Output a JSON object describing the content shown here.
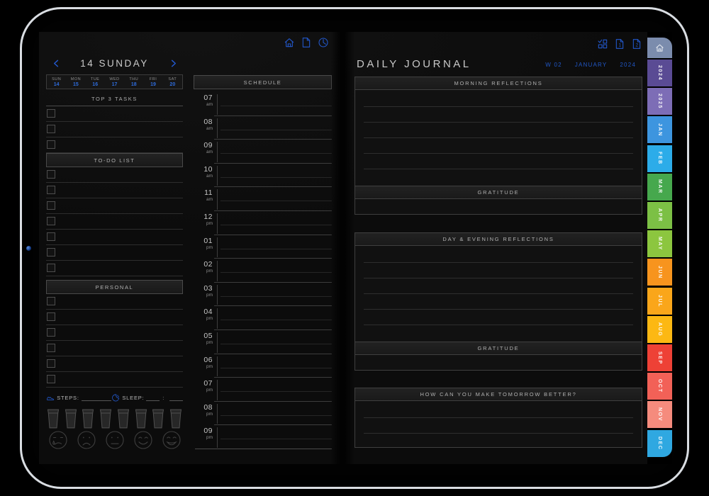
{
  "left_page": {
    "toolbar": {
      "icons": [
        "home-icon",
        "new-page-icon",
        "recent-icon"
      ]
    },
    "date_header": {
      "title": "14 SUNDAY"
    },
    "week": {
      "days": [
        "SUN",
        "MON",
        "TUE",
        "WED",
        "THU",
        "FRI",
        "SAT"
      ],
      "dates": [
        "14",
        "15",
        "16",
        "17",
        "18",
        "19",
        "20"
      ]
    },
    "sections": {
      "top3": {
        "title": "TOP 3 TASKS",
        "rows": 3
      },
      "todo": {
        "title": "TO-DO LIST",
        "rows": 7
      },
      "personal": {
        "title": "PERSONAL",
        "rows": 6
      }
    },
    "trackers": {
      "steps_label": "STEPS:",
      "sleep_label": "SLEEP:",
      "sleep_separator": ":",
      "water_cups": 8,
      "moods": [
        "crying",
        "sad",
        "neutral",
        "happy",
        "laughing"
      ]
    }
  },
  "schedule": {
    "title": "SCHEDULE",
    "slots": [
      {
        "hour": "07",
        "meridiem": "am"
      },
      {
        "hour": "08",
        "meridiem": "am"
      },
      {
        "hour": "09",
        "meridiem": "am"
      },
      {
        "hour": "10",
        "meridiem": "am"
      },
      {
        "hour": "11",
        "meridiem": "am"
      },
      {
        "hour": "12",
        "meridiem": "pm"
      },
      {
        "hour": "01",
        "meridiem": "pm"
      },
      {
        "hour": "02",
        "meridiem": "pm"
      },
      {
        "hour": "03",
        "meridiem": "pm"
      },
      {
        "hour": "04",
        "meridiem": "pm"
      },
      {
        "hour": "05",
        "meridiem": "pm"
      },
      {
        "hour": "06",
        "meridiem": "pm"
      },
      {
        "hour": "07",
        "meridiem": "pm"
      },
      {
        "hour": "08",
        "meridiem": "pm"
      },
      {
        "hour": "09",
        "meridiem": "pm"
      }
    ]
  },
  "right_page": {
    "title": "DAILY JOURNAL",
    "toolbar": {
      "icons": [
        "grid-check-icon",
        "page-1-icon",
        "page-2-icon"
      ]
    },
    "meta": {
      "week": "W 02",
      "month": "JANUARY",
      "year": "2024"
    },
    "sections": [
      {
        "header": "MORNING REFLECTIONS",
        "lines": 5,
        "subheader": "GRATITUDE"
      },
      {
        "header": "DAY & EVENING REFLECTIONS",
        "lines": 5,
        "subheader": "GRATITUDE"
      },
      {
        "header": "HOW CAN YOU MAKE TOMORROW BETTER?",
        "lines": 2
      }
    ]
  },
  "tabs": [
    {
      "label": "",
      "icon": "home-icon",
      "color": "#7b8cad"
    },
    {
      "label": "2024",
      "color": "#5a4b94"
    },
    {
      "label": "2025",
      "color": "#7d6db6"
    },
    {
      "label": "JAN",
      "color": "#3d95df"
    },
    {
      "label": "FEB",
      "color": "#2cace9"
    },
    {
      "label": "MAR",
      "color": "#46a84d"
    },
    {
      "label": "APR",
      "color": "#7cc045"
    },
    {
      "label": "MAY",
      "color": "#8cc63f"
    },
    {
      "label": "JUN",
      "color": "#f7941e"
    },
    {
      "label": "JUL",
      "color": "#faa61a"
    },
    {
      "label": "AUG",
      "color": "#fcb813"
    },
    {
      "label": "SEP",
      "color": "#ee4136"
    },
    {
      "label": "OCT",
      "color": "#f26157"
    },
    {
      "label": "NOV",
      "color": "#f58b7d"
    },
    {
      "label": "DEC",
      "color": "#2fa8e1"
    }
  ],
  "colors": {
    "accent_blue": "#2258cc",
    "page_bg": "#0d0d0d",
    "header_bar_bg": "#1d1d1d"
  }
}
